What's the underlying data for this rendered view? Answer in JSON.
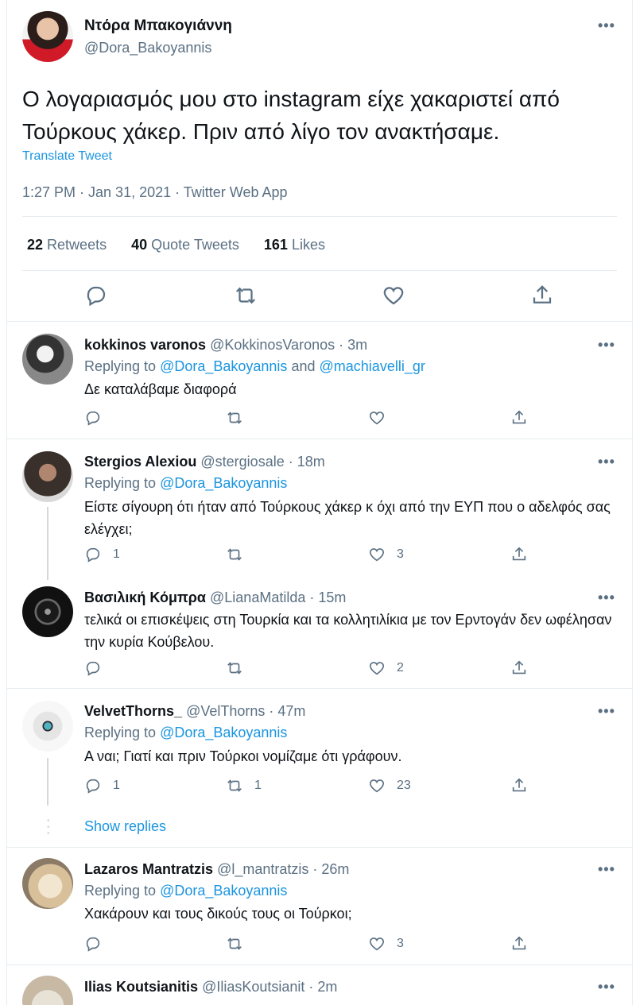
{
  "main_tweet": {
    "name": "Ντόρα Μπακογιάννη",
    "handle": "@Dora_Bakoyannis",
    "text": "Ο λογαριασμός μου στο instagram είχε χακαριστεί από Τούρκους χάκερ. Πριν από λίγο τον ανακτήσαμε.",
    "translate_label": "Translate Tweet",
    "meta": "1:27 PM · Jan 31, 2021 · Twitter Web App",
    "stats": {
      "retweets_count": "22",
      "retweets_label": "Retweets",
      "quotes_count": "40",
      "quotes_label": "Quote Tweets",
      "likes_count": "161",
      "likes_label": "Likes"
    }
  },
  "more_label": "•••",
  "replies": [
    {
      "name": "kokkinos varonos",
      "handle_time": "@KokkinosVaronos · 3m",
      "replying_prefix": "Replying to",
      "replying_to_1": "@Dora_Bakoyannis",
      "replying_and": "and",
      "replying_to_2": "@machiavelli_gr",
      "text": "Δε καταλάβαμε διαφορά",
      "reply_count": "",
      "retweet_count": "",
      "like_count": ""
    },
    {
      "name": "Stergios Alexiou",
      "handle_time": "@stergiosale · 18m",
      "replying_prefix": "Replying to",
      "replying_to_1": "@Dora_Bakoyannis",
      "text": "Είστε σίγουρη ότι ήταν από Τούρκους χάκερ κ όχι από την ΕΥΠ που ο αδελφός σας ελέγχει;",
      "reply_count": "1",
      "retweet_count": "",
      "like_count": "3"
    },
    {
      "name": "Βασιλική Κόμπρα",
      "handle_time": "@LianaMatilda · 15m",
      "text": "τελικά οι επισκέψεις στη Τουρκία και τα κολλητιλίκια με τον Ερντογάν δεν ωφέλησαν την κυρία Κούβελου.",
      "reply_count": "",
      "retweet_count": "",
      "like_count": "2"
    },
    {
      "name": "VelvetThorns_",
      "handle_time": "@VelThorns · 47m",
      "replying_prefix": "Replying to",
      "replying_to_1": "@Dora_Bakoyannis",
      "text": "Α ναι; Γιατί και πριν Τούρκοι νομίζαμε ότι γράφουν.",
      "reply_count": "1",
      "retweet_count": "1",
      "like_count": "23"
    },
    {
      "name": "Lazaros Mantratzis",
      "handle_time": "@l_mantratzis · 26m",
      "replying_prefix": "Replying to",
      "replying_to_1": "@Dora_Bakoyannis",
      "text": "Χακάρουν και τους δικούς τους οι Τούρκοι;",
      "reply_count": "",
      "retweet_count": "",
      "like_count": "3"
    },
    {
      "name": "Ilias Koutsianitis",
      "handle_time": "@IliasKoutsianit · 2m"
    }
  ],
  "show_replies_label": "Show replies",
  "colors": {
    "accent": "#1b95e0",
    "muted": "#5b7083",
    "border": "#e6ecf0"
  }
}
